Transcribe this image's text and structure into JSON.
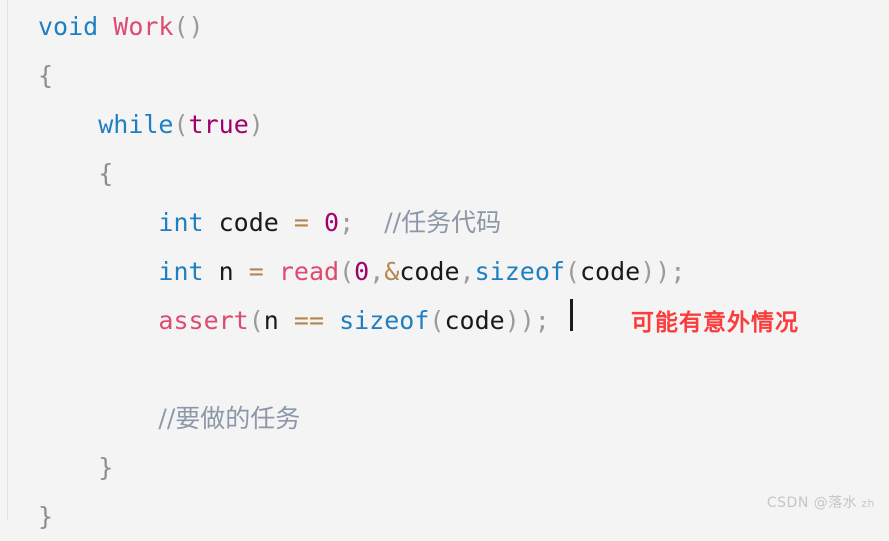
{
  "editor": {
    "background_color": "#f4f4f4",
    "language": "cpp",
    "caret_visible": true,
    "lines": [
      {
        "n": 1,
        "indent": 0,
        "text": "void Work()",
        "tokens": [
          {
            "t": "void",
            "k": "kw"
          },
          {
            "t": " ",
            "k": "plain"
          },
          {
            "t": "Work",
            "k": "fn"
          },
          {
            "t": "()",
            "k": "punct"
          }
        ]
      },
      {
        "n": 2,
        "indent": 0,
        "text": "{",
        "tokens": [
          {
            "t": "{",
            "k": "brace"
          }
        ]
      },
      {
        "n": 3,
        "indent": 1,
        "text": "    while(true)",
        "tokens": [
          {
            "t": "    ",
            "k": "plain"
          },
          {
            "t": "while",
            "k": "kw"
          },
          {
            "t": "(",
            "k": "punct"
          },
          {
            "t": "true",
            "k": "lit"
          },
          {
            "t": ")",
            "k": "punct"
          }
        ]
      },
      {
        "n": 4,
        "indent": 1,
        "text": "    {",
        "tokens": [
          {
            "t": "    ",
            "k": "plain"
          },
          {
            "t": "{",
            "k": "brace"
          }
        ]
      },
      {
        "n": 5,
        "indent": 2,
        "text": "        int code = 0; //任务代码",
        "tokens": [
          {
            "t": "        ",
            "k": "plain"
          },
          {
            "t": "int",
            "k": "kw"
          },
          {
            "t": " code ",
            "k": "plain"
          },
          {
            "t": "=",
            "k": "op"
          },
          {
            "t": " ",
            "k": "plain"
          },
          {
            "t": "0",
            "k": "num"
          },
          {
            "t": ";",
            "k": "punct"
          },
          {
            "t": "  ",
            "k": "plain"
          },
          {
            "t": "//任务代码",
            "k": "comment"
          }
        ]
      },
      {
        "n": 6,
        "indent": 2,
        "text": "        int n = read(0,&code,sizeof(code));",
        "tokens": [
          {
            "t": "        ",
            "k": "plain"
          },
          {
            "t": "int",
            "k": "kw"
          },
          {
            "t": " n ",
            "k": "plain"
          },
          {
            "t": "=",
            "k": "op"
          },
          {
            "t": " ",
            "k": "plain"
          },
          {
            "t": "read",
            "k": "fn"
          },
          {
            "t": "(",
            "k": "punct"
          },
          {
            "t": "0",
            "k": "num"
          },
          {
            "t": ",",
            "k": "punct"
          },
          {
            "t": "&",
            "k": "op"
          },
          {
            "t": "code",
            "k": "plain"
          },
          {
            "t": ",",
            "k": "punct"
          },
          {
            "t": "sizeof",
            "k": "builtin"
          },
          {
            "t": "(",
            "k": "punct"
          },
          {
            "t": "code",
            "k": "plain"
          },
          {
            "t": "))",
            "k": "punct"
          },
          {
            "t": ";",
            "k": "punct"
          }
        ]
      },
      {
        "n": 7,
        "indent": 2,
        "text": "        assert(n == sizeof(code));",
        "tokens": [
          {
            "t": "        ",
            "k": "plain"
          },
          {
            "t": "assert",
            "k": "fn"
          },
          {
            "t": "(",
            "k": "punct"
          },
          {
            "t": "n",
            "k": "plain"
          },
          {
            "t": " ",
            "k": "plain"
          },
          {
            "t": "==",
            "k": "op"
          },
          {
            "t": " ",
            "k": "plain"
          },
          {
            "t": "sizeof",
            "k": "builtin"
          },
          {
            "t": "(",
            "k": "punct"
          },
          {
            "t": "code",
            "k": "plain"
          },
          {
            "t": "))",
            "k": "punct"
          },
          {
            "t": ";",
            "k": "punct"
          }
        ]
      },
      {
        "n": 8,
        "indent": 0,
        "text": "",
        "tokens": []
      },
      {
        "n": 9,
        "indent": 2,
        "text": "        //要做的任务",
        "tokens": [
          {
            "t": "        ",
            "k": "plain"
          },
          {
            "t": "//要做的任务",
            "k": "comment"
          }
        ]
      },
      {
        "n": 10,
        "indent": 1,
        "text": "    }",
        "tokens": [
          {
            "t": "    ",
            "k": "plain"
          },
          {
            "t": "}",
            "k": "brace"
          }
        ]
      },
      {
        "n": 11,
        "indent": 0,
        "text": "}",
        "tokens": [
          {
            "t": "}",
            "k": "brace"
          }
        ]
      }
    ]
  },
  "annotation": {
    "text": "可能有意外情况",
    "color": "#fa3c3c"
  },
  "watermark": {
    "prefix": "CSDN ",
    "handle": "@落水",
    "suffix": " zh",
    "color": "#c6c6c6"
  }
}
